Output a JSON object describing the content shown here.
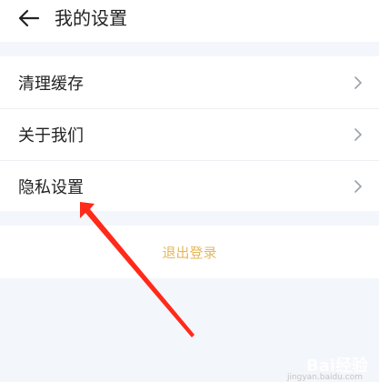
{
  "header": {
    "back_icon": "arrow-left-icon",
    "title": "我的设置"
  },
  "menu": {
    "items": [
      {
        "label": "清理缓存",
        "icon": "chevron-right-icon"
      },
      {
        "label": "关于我们",
        "icon": "chevron-right-icon"
      },
      {
        "label": "隐私设置",
        "icon": "chevron-right-icon"
      }
    ]
  },
  "logout": {
    "label": "退出登录",
    "color": "#e6b85a"
  },
  "annotation": {
    "arrow_color": "#ff2a1a"
  },
  "watermark": {
    "brand": "Bai经验",
    "url": "jingyan.baidu.com"
  }
}
